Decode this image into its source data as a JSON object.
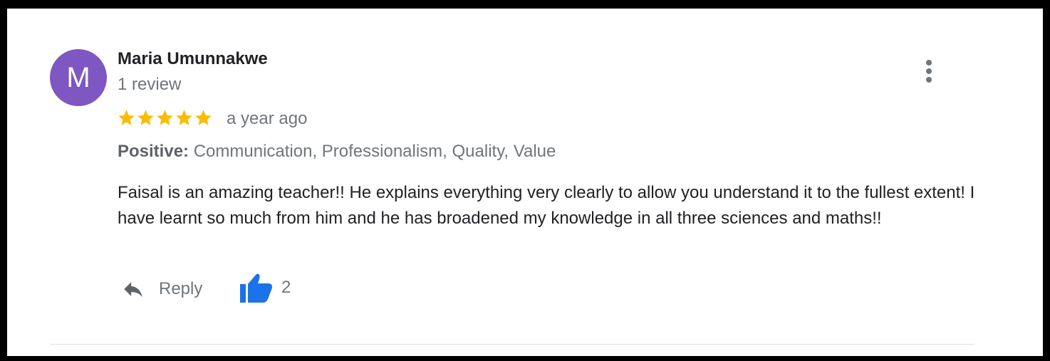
{
  "review": {
    "avatar_letter": "M",
    "avatar_color": "#7e57c2",
    "author_name": "Maria Umunnakwe",
    "review_count": "1 review",
    "rating": 5,
    "rating_max": 5,
    "star_color": "#fbbc04",
    "time_ago": "a year ago",
    "positive_label": "Positive:",
    "positive_values": "Communication, Professionalism, Quality, Value",
    "text": "Faisal is an amazing teacher!! He explains everything very clearly to allow you understand it to the fullest extent! I have learnt so much from him and he has broadened my knowledge in all three sciences and maths!!",
    "more_icon": "more-vert-icon"
  },
  "actions": {
    "reply_icon": "reply-icon",
    "reply_label": "Reply",
    "like_icon": "thumbs-up-icon",
    "like_color": "#1a73e8",
    "like_count": "2"
  }
}
